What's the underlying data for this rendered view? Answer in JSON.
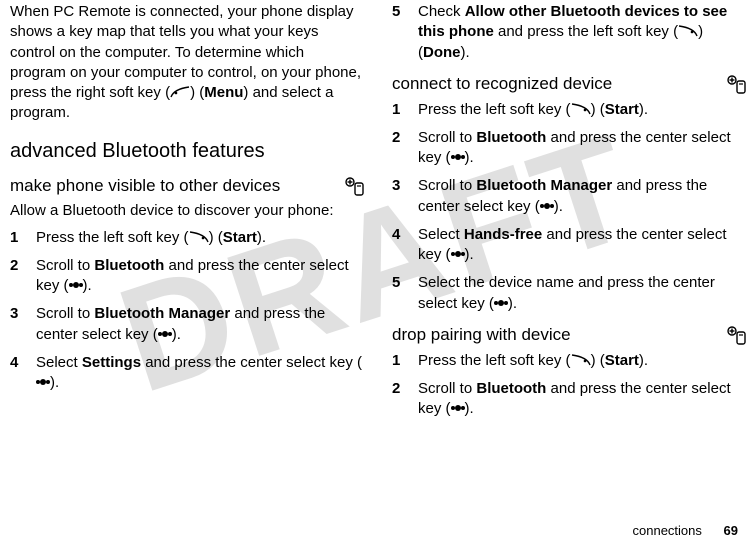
{
  "watermark": "DRAFT",
  "left": {
    "intro": "When PC Remote is connected, your phone display shows a key map that tells you what your keys control on the computer. To determine which program on your computer to control, on your phone, press the right soft key (",
    "intro_key": "Menu",
    "intro_tail": ") and select a program.",
    "section_title": "advanced Bluetooth features",
    "sub1_title": "make phone visible to other devices",
    "sub1_intro": "Allow a Bluetooth device to discover your phone:",
    "steps": [
      {
        "num": "1",
        "pre": "Press the left soft key (",
        "key": "Start",
        "post": ")."
      },
      {
        "num": "2",
        "t1": "Scroll to ",
        "b1": "Bluetooth",
        "t2": " and press the center select key (",
        "post": ")."
      },
      {
        "num": "3",
        "t1": "Scroll to ",
        "b1": "Bluetooth Manager",
        "t2": " and press the center select key (",
        "post": ")."
      },
      {
        "num": "4",
        "t1": "Select ",
        "b1": "Settings",
        "t2": " and press the center select key (",
        "post": ")."
      }
    ]
  },
  "right": {
    "step5": {
      "num": "5",
      "t1": "Check ",
      "b1": "Allow other Bluetooth devices to see this phone",
      "t2": " and press the left soft key (",
      "key": "Done",
      "post": ")."
    },
    "sub2_title": "connect to recognized device",
    "steps2": [
      {
        "num": "1",
        "pre": "Press the left soft key (",
        "key": "Start",
        "post": ")."
      },
      {
        "num": "2",
        "t1": "Scroll to ",
        "b1": "Bluetooth",
        "t2": " and press the center select key (",
        "post": ")."
      },
      {
        "num": "3",
        "t1": "Scroll to ",
        "b1": "Bluetooth Manager",
        "t2": " and press the center select key (",
        "post": ")."
      },
      {
        "num": "4",
        "t1": "Select ",
        "b1": "Hands-free",
        "t2": " and press the center select key (",
        "post": ")."
      },
      {
        "num": "5",
        "t1": "Select the device name and press the center select key (",
        "post": ")."
      }
    ],
    "sub3_title": "drop pairing with device",
    "steps3": [
      {
        "num": "1",
        "pre": "Press the left soft key (",
        "key": "Start",
        "post": ")."
      },
      {
        "num": "2",
        "t1": "Scroll to ",
        "b1": "Bluetooth",
        "t2": " and press the center select key (",
        "post": ")."
      }
    ]
  },
  "footer_label": "connections",
  "page_number": "69"
}
